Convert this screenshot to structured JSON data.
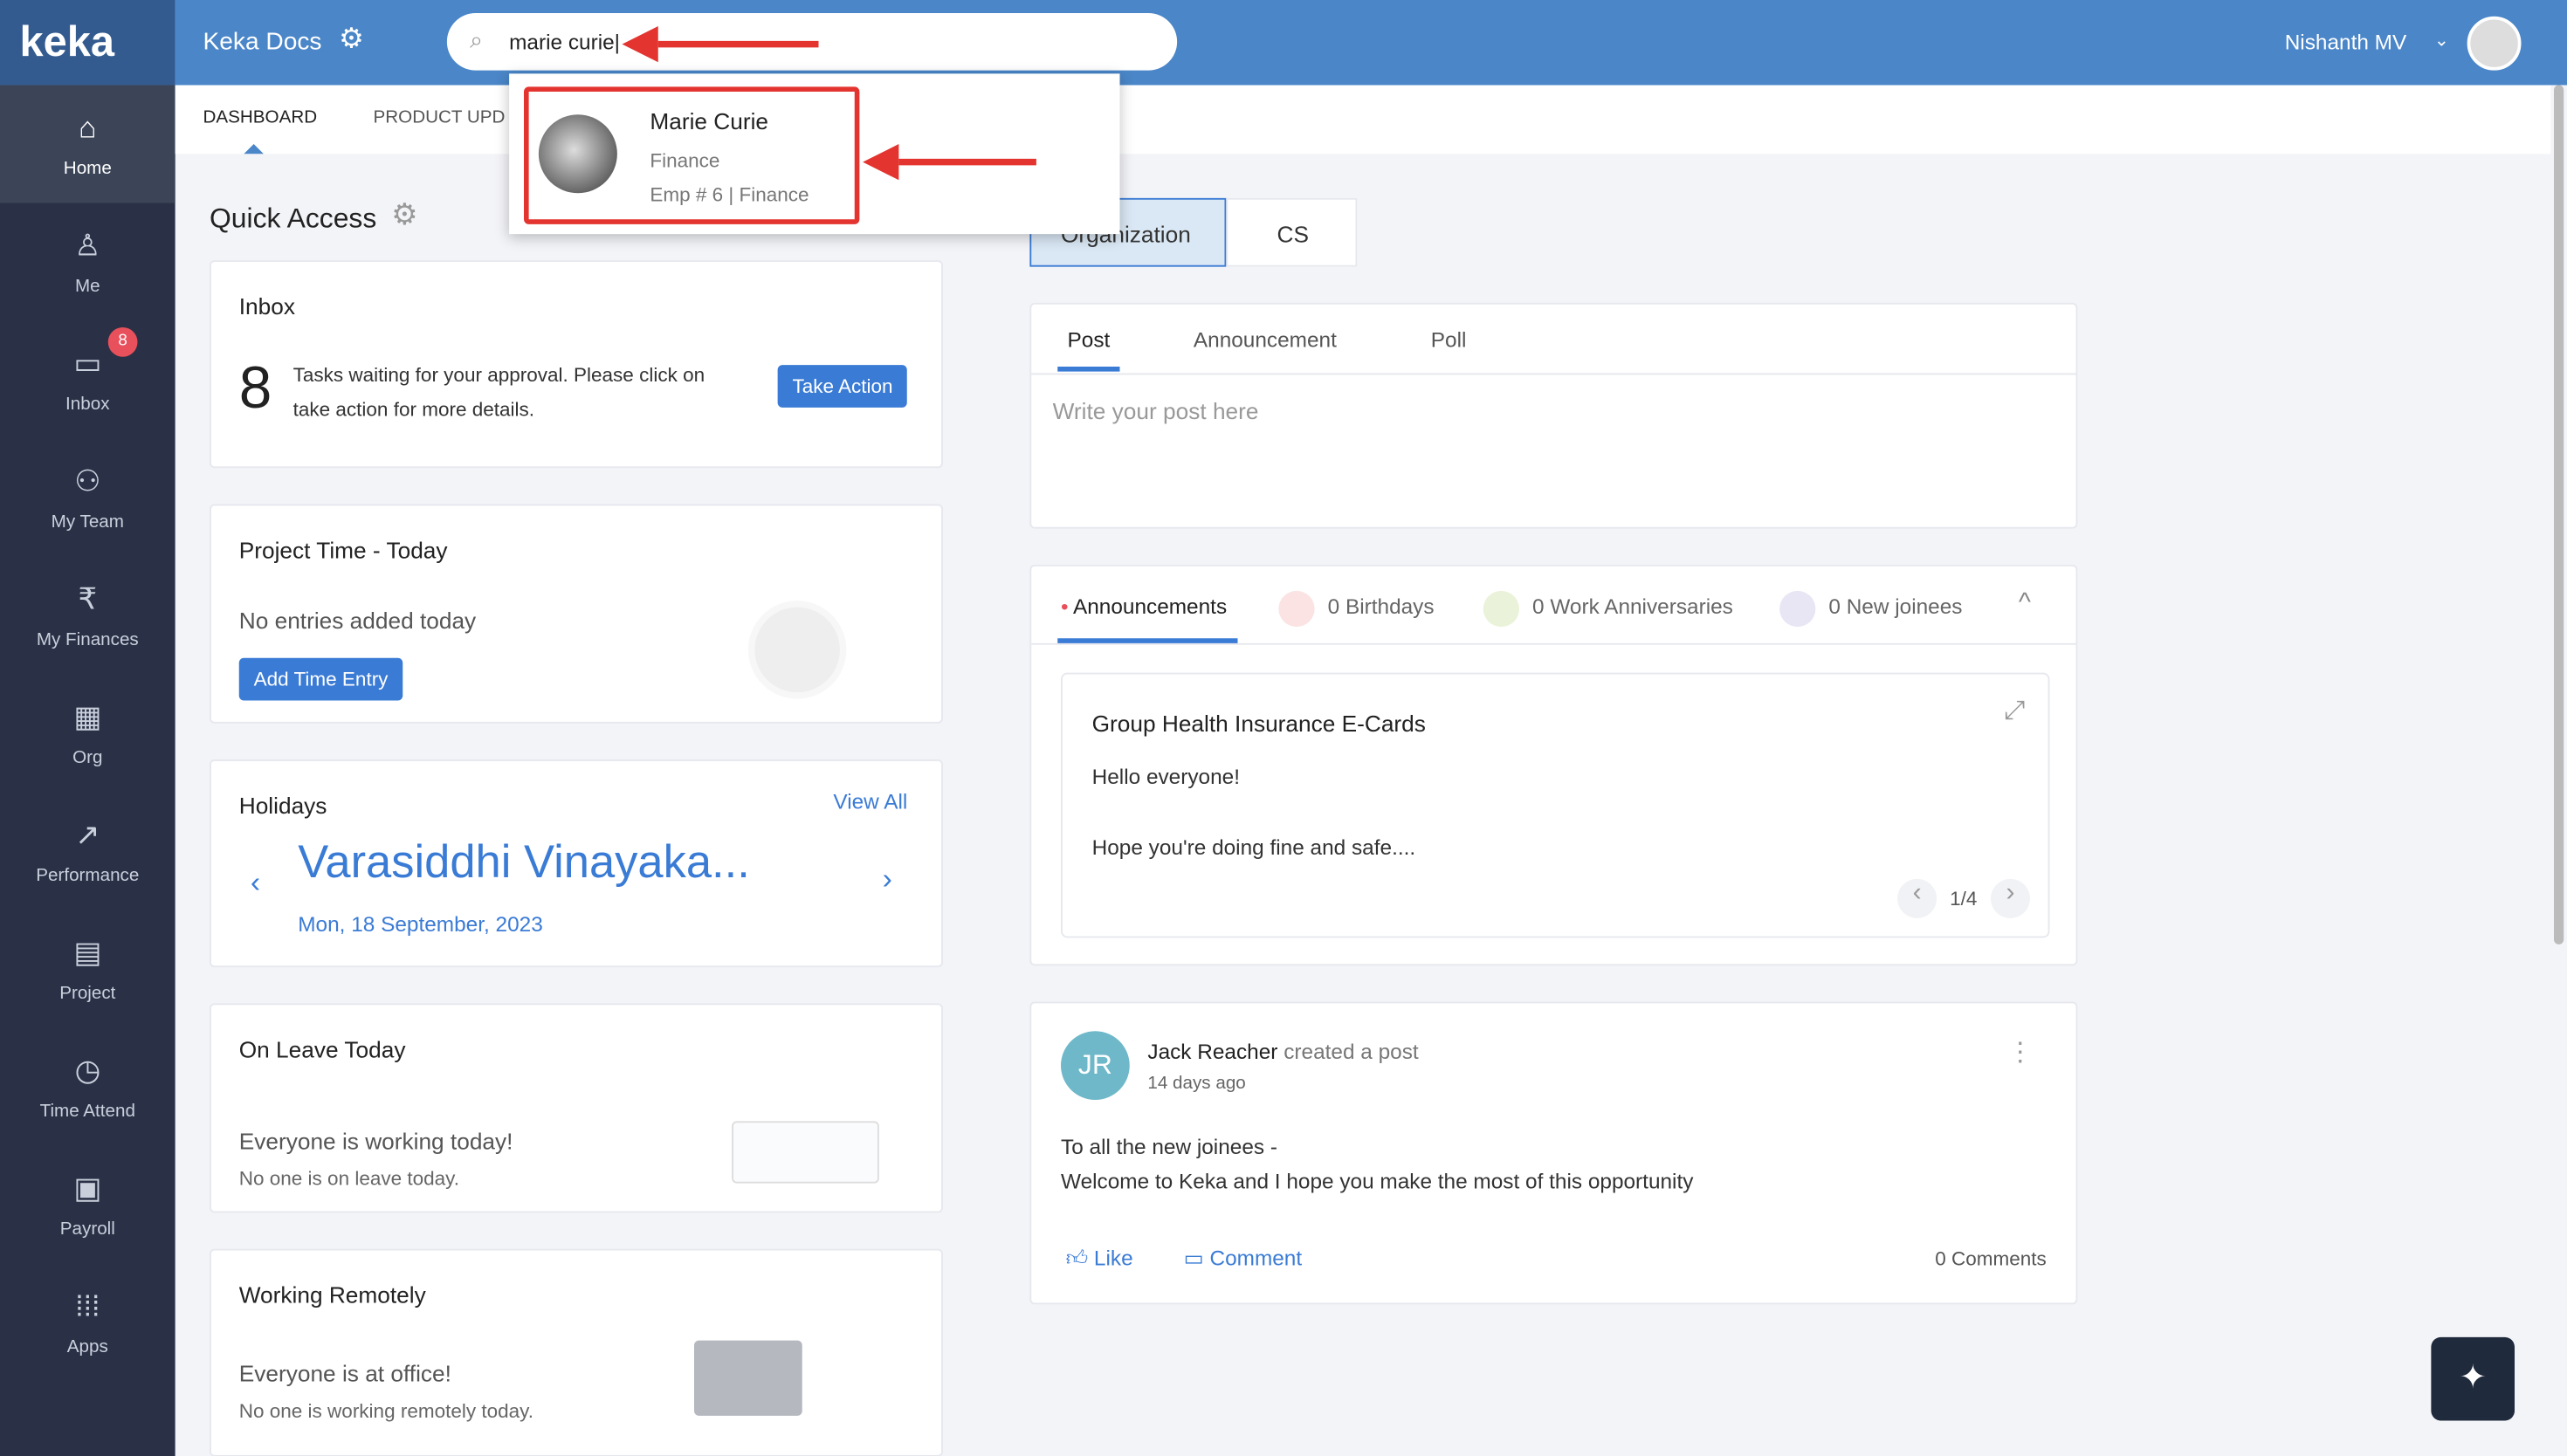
{
  "logo": "keka",
  "sidebar": {
    "items": [
      {
        "label": "Home",
        "icon": "home-icon"
      },
      {
        "label": "Me",
        "icon": "user-icon"
      },
      {
        "label": "Inbox",
        "icon": "inbox-icon",
        "badge": "8"
      },
      {
        "label": "My Team",
        "icon": "team-icon"
      },
      {
        "label": "My Finances",
        "icon": "rupee-icon"
      },
      {
        "label": "Org",
        "icon": "org-icon"
      },
      {
        "label": "Performance",
        "icon": "chart-icon"
      },
      {
        "label": "Project",
        "icon": "clipboard-icon"
      },
      {
        "label": "Time Attend",
        "icon": "clock-icon"
      },
      {
        "label": "Payroll",
        "icon": "payroll-icon"
      },
      {
        "label": "Apps",
        "icon": "apps-icon"
      }
    ]
  },
  "header": {
    "brand": "Keka Docs",
    "search_value": "marie curie",
    "user": "Nishanth MV"
  },
  "search_result": {
    "name": "Marie Curie",
    "dept": "Finance",
    "emp": "Emp # 6 | Finance"
  },
  "tabs": [
    "DASHBOARD",
    "PRODUCT UPD"
  ],
  "quick_access": "Quick Access",
  "inbox": {
    "title": "Inbox",
    "count": "8",
    "text1": "Tasks waiting for your approval. Please click on",
    "text2": "take action for more details.",
    "button": "Take Action"
  },
  "project_time": {
    "title": "Project Time - Today",
    "text": "No entries added today",
    "button": "Add Time Entry"
  },
  "holidays": {
    "title": "Holidays",
    "view_all": "View All",
    "name": "Varasiddhi Vinayaka...",
    "date": "Mon, 18 September, 2023"
  },
  "on_leave": {
    "title": "On Leave Today",
    "text": "Everyone is working today!",
    "sub": "No one is on leave today."
  },
  "remote": {
    "title": "Working Remotely",
    "text": "Everyone is at office!",
    "sub": "No one is working remotely today."
  },
  "org_tabs": [
    "Organization",
    "CS"
  ],
  "post_tabs": [
    "Post",
    "Announcement",
    "Poll"
  ],
  "post_placeholder": "Write your post here",
  "ann_tabs": [
    "Announcements",
    "0 Birthdays",
    "0 Work Anniversaries",
    "0 New joinees"
  ],
  "announcement": {
    "title": "Group Health Insurance E-Cards",
    "line1": "Hello everyone!",
    "line2": "Hope you're doing fine and safe....",
    "pager": "1/4"
  },
  "feed": {
    "initials": "JR",
    "author": "Jack Reacher",
    "action": "created a post",
    "time": "14 days ago",
    "line1": "To all the new joinees -",
    "line2": "Welcome to Keka and I hope you make the most of this opportunity",
    "like": "Like",
    "comment": "Comment",
    "comments": "0 Comments"
  }
}
